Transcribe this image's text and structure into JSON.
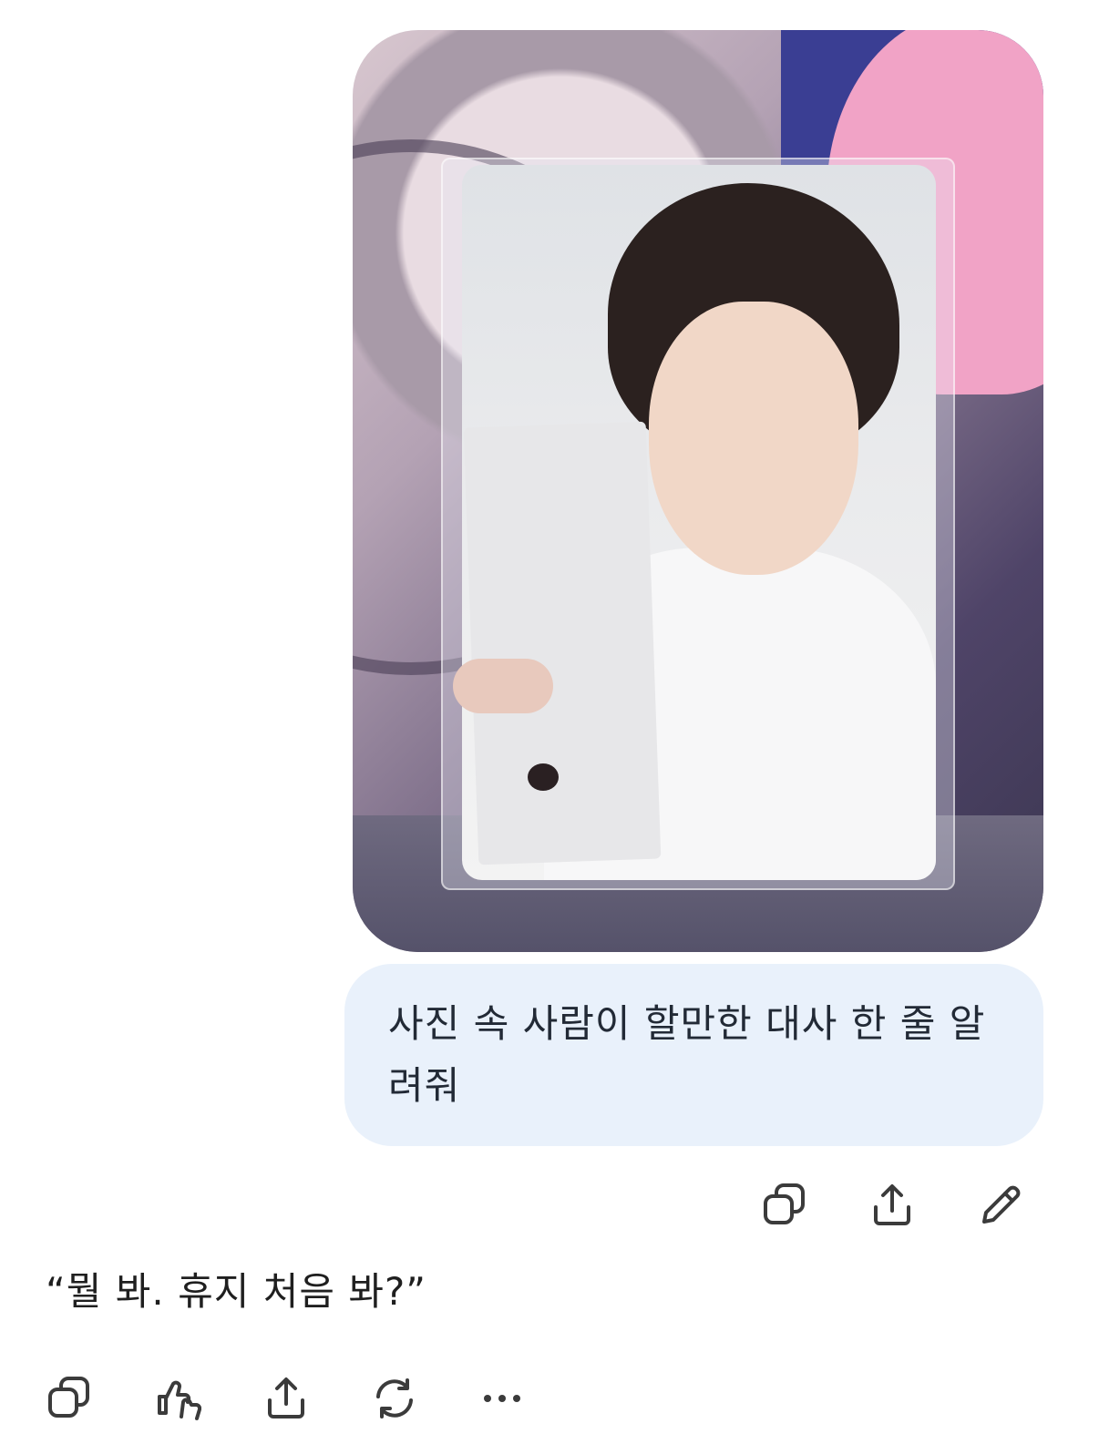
{
  "conversation": {
    "user_image": {
      "icon": "photo-attachment"
    },
    "user_message": {
      "text": "사진 속 사람이 할만한 대사 한 줄 알려줘"
    },
    "user_actions": [
      {
        "icon": "copy-icon"
      },
      {
        "icon": "share-icon"
      },
      {
        "icon": "edit-icon"
      }
    ],
    "assistant_message": {
      "text": "“뭘 봐. 휴지 처음 봐?”"
    },
    "assistant_actions": [
      {
        "icon": "copy-icon"
      },
      {
        "icon": "thumbs-icon"
      },
      {
        "icon": "share-icon"
      },
      {
        "icon": "regenerate-icon"
      },
      {
        "icon": "more-icon"
      }
    ]
  }
}
